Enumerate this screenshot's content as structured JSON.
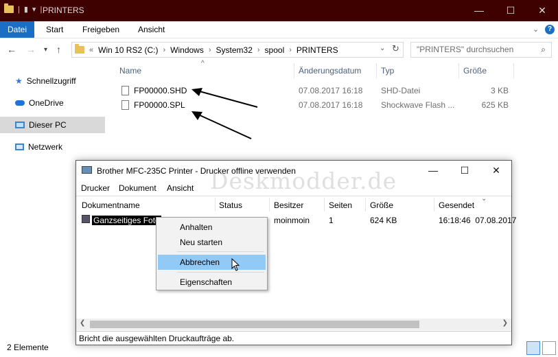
{
  "explorer": {
    "window_title": "PRINTERS",
    "ribbon_tabs": [
      "Datei",
      "Start",
      "Freigeben",
      "Ansicht"
    ],
    "address": {
      "overflow": "«",
      "segments": [
        "Win 10 RS2 (C:)",
        "Windows",
        "System32",
        "spool",
        "PRINTERS"
      ]
    },
    "search_placeholder": "\"PRINTERS\" durchsuchen",
    "sidebar": [
      {
        "label": "Schnellzugriff",
        "icon": "star-icon"
      },
      {
        "label": "OneDrive",
        "icon": "cloud-icon"
      },
      {
        "label": "Dieser PC",
        "icon": "computer-icon"
      },
      {
        "label": "Netzwerk",
        "icon": "network-icon"
      }
    ],
    "columns": {
      "name": "Name",
      "date": "Änderungsdatum",
      "type": "Typ",
      "size": "Größe"
    },
    "files": [
      {
        "name": "FP00000.SHD",
        "date": "07.08.2017 16:18",
        "type": "SHD-Datei",
        "size": "3 KB"
      },
      {
        "name": "FP00000.SPL",
        "date": "07.08.2017 16:18",
        "type": "Shockwave Flash ...",
        "size": "625 KB"
      }
    ],
    "status": "2 Elemente"
  },
  "printer_window": {
    "title": "Brother MFC-235C Printer  -  Drucker offline verwenden",
    "menu": [
      "Drucker",
      "Dokument",
      "Ansicht"
    ],
    "columns": [
      "Dokumentname",
      "Status",
      "Besitzer",
      "Seiten",
      "Größe",
      "Gesendet"
    ],
    "job": {
      "name": "Ganzseitiges Foto",
      "owner": "moinmoin",
      "pages": "1",
      "size": "624 KB",
      "sent": "16:18:46  07.08.2017"
    },
    "status": "Bricht die ausgewählten Druckaufträge ab."
  },
  "context_menu": {
    "items": [
      "Anhalten",
      "Neu starten",
      "Abbrechen",
      "Eigenschaften"
    ],
    "highlighted": "Abbrechen"
  },
  "watermark": "Deskmodder.de",
  "colors": {
    "titlebar": "#3f0000",
    "file_tab": "#1a6fc4",
    "selection": "#d9d9d9",
    "menu_highlight": "#91c9f7"
  }
}
